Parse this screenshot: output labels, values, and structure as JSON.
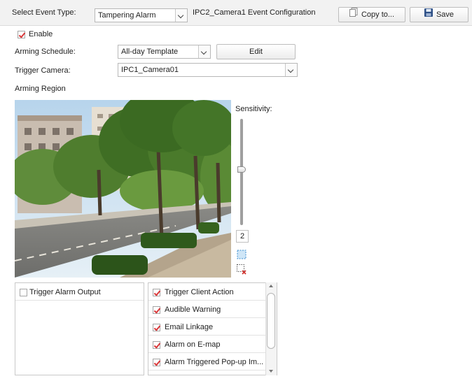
{
  "header": {
    "event_type_label": "Select Event Type:",
    "event_type_value": "Tampering Alarm",
    "config_title": "IPC2_Camera1 Event Configuration",
    "copy_label": "Copy to...",
    "save_label": "Save"
  },
  "form": {
    "enable_label": "Enable",
    "enable_checked": true,
    "schedule_label": "Arming Schedule:",
    "schedule_value": "All-day Template",
    "edit_label": "Edit",
    "camera_label": "Trigger Camera:",
    "camera_value": "IPC1_Camera01",
    "region_label": "Arming Region"
  },
  "sensitivity": {
    "label": "Sensitivity:",
    "value": "2"
  },
  "linkage_left": [
    {
      "label": "Trigger Alarm Output",
      "checked": false
    }
  ],
  "linkage_right": [
    {
      "label": "Trigger Client Action",
      "checked": true
    },
    {
      "label": "Audible Warning",
      "checked": true
    },
    {
      "label": "Email Linkage",
      "checked": true
    },
    {
      "label": "Alarm on E-map",
      "checked": true
    },
    {
      "label": "Alarm Triggered Pop-up Im...",
      "checked": true
    }
  ],
  "icons": {
    "copy": "copy-icon",
    "save": "floppy-disk-icon",
    "full_region": "select-full-region-icon",
    "clear_region": "clear-region-icon"
  }
}
